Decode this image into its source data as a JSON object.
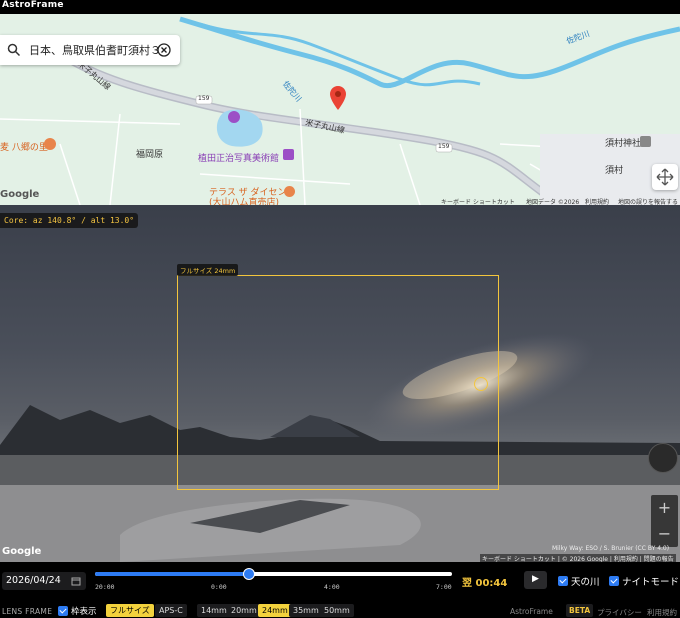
{
  "app": {
    "title": "AstroFrame"
  },
  "search": {
    "value": "日本、鳥取県伯耆町須村３"
  },
  "map": {
    "labels": {
      "road_yonago_w": "米子丸山線",
      "road_yonago_e": "米子丸山線",
      "river_sada_1": "佐陀川",
      "river_sada_2": "佐陀川",
      "route_159a": "159",
      "route_159b": "159",
      "fukuokahara": "福岡原",
      "sumura": "須村",
      "sumura_shrine": "須村神社",
      "hachigo": "麦 八郷の里",
      "ueda_museum": "植田正治写真美術館",
      "terrace_1": "テラス ザ ダイセン",
      "terrace_2": "(大山ハム直売店)"
    },
    "google": "Google",
    "attribution": [
      "キーボード ショートカット",
      "地図データ ©2026",
      "利用規約",
      "地図の誤りを報告する"
    ]
  },
  "streetview": {
    "core": "Core: az 140.8° / alt 13.0°",
    "frame_label": "フルサイズ 24mm",
    "google": "Google",
    "attr_milkyway": "Milky Way: ESO / S. Brunier (CC BY 4.0)",
    "attr_bottom": "キーボード ショートカット | © 2026 Google | 利用規約 | 問題の報告"
  },
  "controls": {
    "date": "2026/04/24",
    "slider": {
      "ticks": [
        "20:00",
        "0:00",
        "4:00",
        "7:00"
      ],
      "position": 0.43
    },
    "time": "翌 00:44",
    "play": "▶",
    "milkyway": "天の川",
    "nightmode": "ナイトモード",
    "lens_frame": "LENS FRAME",
    "frame_show": "枠表示",
    "sensors": [
      "フルサイズ",
      "APS-C"
    ],
    "active_sensor": 0,
    "focals": [
      "14mm",
      "20mm",
      "24mm",
      "35mm",
      "50mm"
    ],
    "active_focal": 2,
    "footer": {
      "brand": "AstroFrame",
      "beta": "BETA",
      "privacy": "プライバシー",
      "terms": "利用規約"
    }
  },
  "colors": {
    "accent": "#f3c53d",
    "blue": "#2d7bf3"
  }
}
